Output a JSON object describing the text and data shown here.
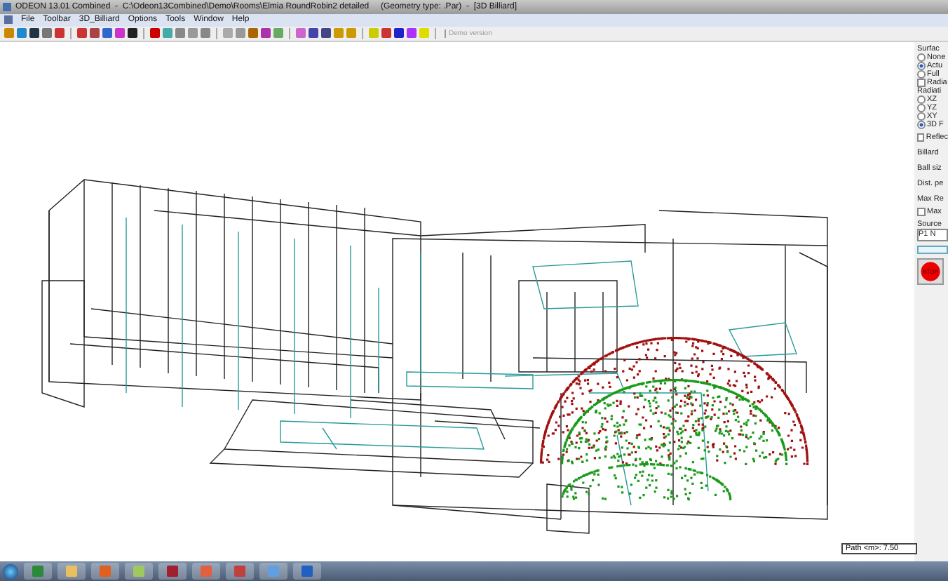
{
  "window": {
    "title": "ODEON 13.01 Combined  -  C:\\Odeon13Combined\\Demo\\Rooms\\Elmia RoundRobin2 detailed     (Geometry type: .Par)  -  [3D Billiard]"
  },
  "menu": [
    "File",
    "Toolbar",
    "3D_Billiard",
    "Options",
    "Tools",
    "Window",
    "Help"
  ],
  "toolbar": {
    "demo_label": "Demo version"
  },
  "side_panel": {
    "surface_label": "Surfac",
    "surface_options": [
      {
        "label": "None",
        "selected": false
      },
      {
        "label": "Actu",
        "selected": true
      },
      {
        "label": "Full",
        "selected": false
      }
    ],
    "radiation_check": {
      "label": "Radia",
      "checked": false
    },
    "radiation_label": "Radiati",
    "radiation_options": [
      {
        "label": "XZ",
        "selected": false
      },
      {
        "label": "YZ",
        "selected": false
      },
      {
        "label": "XY",
        "selected": false
      },
      {
        "label": "3D F",
        "selected": true
      }
    ],
    "reflection_check": {
      "label": "Reflec",
      "checked": false
    },
    "fields": [
      "Billard",
      "Ball siz",
      "Dist. pe",
      "Max Re"
    ],
    "max_check": {
      "label": "Max",
      "checked": false
    },
    "source_label": "Source",
    "source_value": "P1 N",
    "progress": {
      "level": 0
    },
    "stop_button": "STOP"
  },
  "status": {
    "path": "Path <m>: 7.50"
  }
}
